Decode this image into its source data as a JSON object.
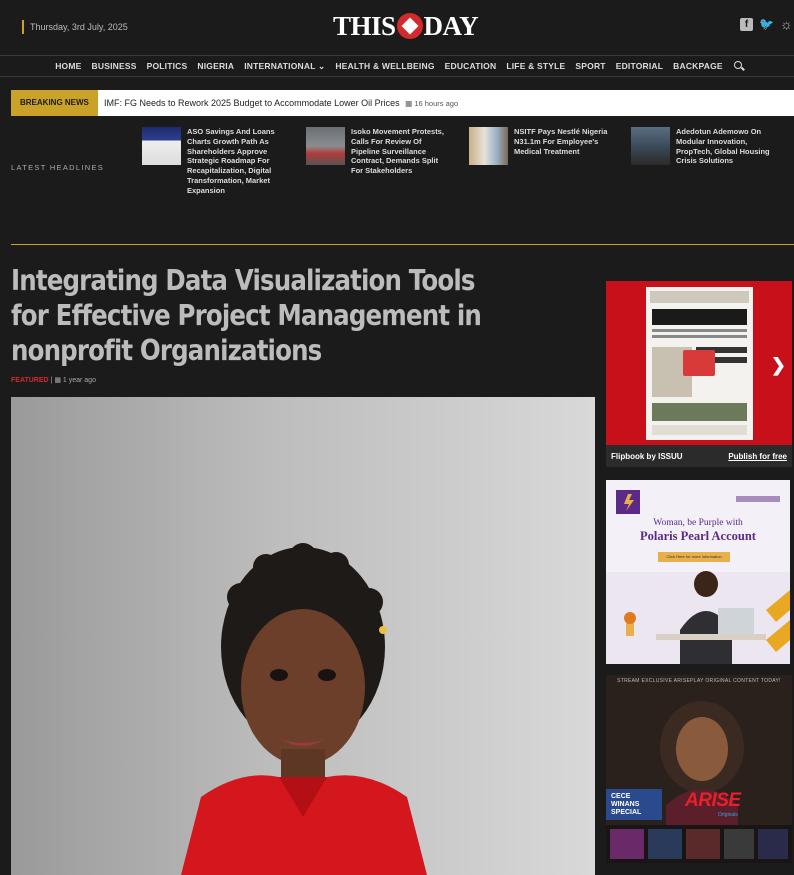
{
  "header": {
    "date": "Thursday, 3rd July, 2025",
    "logo_left": "THIS",
    "logo_right": "DAY",
    "social_icons": [
      "facebook-icon",
      "twitter-icon",
      "theme-toggle-icon"
    ]
  },
  "nav": {
    "items": [
      "HOME",
      "BUSINESS",
      "POLITICS",
      "NIGERIA",
      "INTERNATIONAL",
      "HEALTH & WELLBEING",
      "EDUCATION",
      "LIFE & STYLE",
      "SPORT",
      "EDITORIAL",
      "BACKPAGE"
    ],
    "dropdown_index": 4
  },
  "breaking": {
    "label": "BREAKING NEWS",
    "text": "IMF: FG Needs to Rework 2025 Budget to Accommodate Lower Oil Prices",
    "time": "16 hours ago"
  },
  "latest": {
    "label": "LATEST HEADLINES",
    "items": [
      {
        "title": "ASO Savings And Loans Charts Growth Path As Shareholders Approve Strategic Roadmap For Recapitalization, Digital Transformation, Market Expansion"
      },
      {
        "title": "Isoko Movement Protests, Calls For Review Of Pipeline Surveillance Contract, Demands Split For Stakeholders"
      },
      {
        "title": "NSITF Pays Nestlé Nigeria N31.1m For Employee's Medical Treatment"
      },
      {
        "title": "Adedotun Ademowo On Modular Innovation, PropTech, Global Housing Crisis Solutions"
      }
    ]
  },
  "article": {
    "title": "Integrating Data Visualization Tools for Effective Project Management in nonprofit Organizations",
    "tag": "FEATURED",
    "time": "1 year ago"
  },
  "sidebar": {
    "flipbook_label": "Flipbook by",
    "flipbook_brand": "ISSUU",
    "flipbook_link": "Publish for free",
    "ad1": {
      "line1": "Woman, be Purple with",
      "line2": "Polaris Pearl Account",
      "button": "Click Here for more information"
    },
    "ad2": {
      "top": "STREAM EXCLUSIVE ARISEPLAY ORIGINAL CONTENT TODAY!",
      "cece": [
        "CECE",
        "WINANS",
        "SPECIAL"
      ],
      "brand": "ARISE",
      "brand_sub": "Originals"
    }
  },
  "colors": {
    "accent_gold": "#c9a227",
    "brand_red": "#d42a2a",
    "background": "#1b1b1b"
  }
}
